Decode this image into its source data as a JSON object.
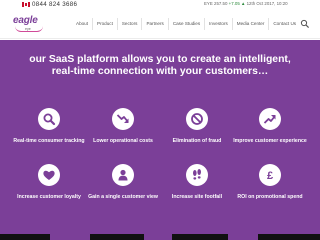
{
  "topbar": {
    "phone": "0844 824 3686",
    "ticker_symbol": "EYE 257.50",
    "ticker_change": "+7.05 ▲",
    "ticker_date": "12th Oct 2017, 10:20"
  },
  "header": {
    "logo_text": "eagle",
    "logo_sub": "eye",
    "nav": [
      "About",
      "Product",
      "Sectors",
      "Partners",
      "Case Studies",
      "Investors",
      "Media Center",
      "Contact Us"
    ]
  },
  "hero": {
    "headline": "our SaaS platform allows you to create an intelligent, real-time connection with your customers…",
    "features": [
      {
        "icon": "search-icon",
        "label": "Real-time consumer tracking"
      },
      {
        "icon": "trending-down-icon",
        "label": "Lower operational costs"
      },
      {
        "icon": "no-fraud-icon",
        "label": "Elimination of fraud"
      },
      {
        "icon": "trending-up-icon",
        "label": "Improve customer experience"
      },
      {
        "icon": "heart-icon",
        "label": "Increase customer loyalty"
      },
      {
        "icon": "user-icon",
        "label": "Gain a single customer view"
      },
      {
        "icon": "footsteps-icon",
        "label": "Increase site footfall"
      },
      {
        "icon": "pound-icon",
        "label": "ROI on promotional spend"
      }
    ]
  },
  "colors": {
    "brand_purple": "#7b3f98",
    "white": "#ffffff"
  }
}
